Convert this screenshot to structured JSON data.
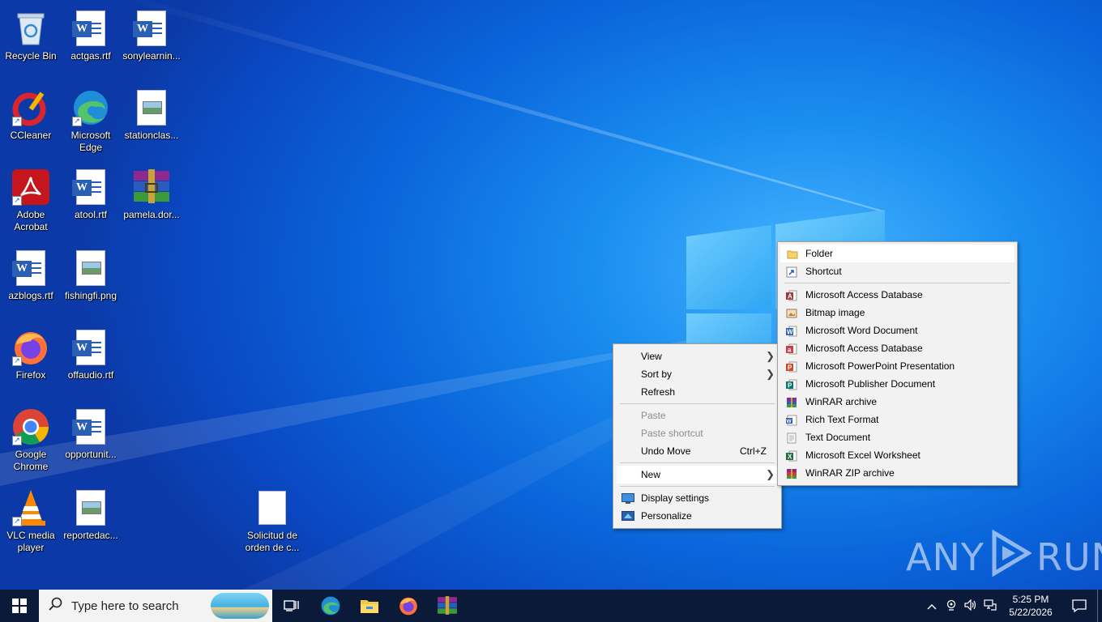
{
  "desktop": {
    "icons": [
      {
        "label": "Recycle Bin"
      },
      {
        "label": "actgas.rtf"
      },
      {
        "label": "sonylearnin..."
      },
      {
        "label": "CCleaner"
      },
      {
        "label": "Microsoft Edge"
      },
      {
        "label": "stationclas..."
      },
      {
        "label": "Adobe Acrobat"
      },
      {
        "label": "atool.rtf"
      },
      {
        "label": "pamela.dor..."
      },
      {
        "label": "azblogs.rtf"
      },
      {
        "label": "fishingfi.png"
      },
      {
        "label": "Firefox"
      },
      {
        "label": "offaudio.rtf"
      },
      {
        "label": "Google Chrome"
      },
      {
        "label": "opportunit..."
      },
      {
        "label": "VLC media player"
      },
      {
        "label": "reportedac..."
      },
      {
        "label": "Solicitud de orden de c..."
      }
    ]
  },
  "context_menu": {
    "items": [
      {
        "label": "View",
        "submenu": true
      },
      {
        "label": "Sort by",
        "submenu": true
      },
      {
        "label": "Refresh"
      },
      {
        "label": "Paste",
        "disabled": true
      },
      {
        "label": "Paste shortcut",
        "disabled": true
      },
      {
        "label": "Undo Move",
        "accelerator": "Ctrl+Z"
      },
      {
        "label": "New",
        "submenu": true,
        "highlighted": true
      },
      {
        "label": "Display settings"
      },
      {
        "label": "Personalize"
      }
    ]
  },
  "new_submenu": {
    "items": [
      {
        "label": "Folder",
        "icon": "folder-icon",
        "highlighted": true
      },
      {
        "label": "Shortcut",
        "icon": "shortcut-icon"
      },
      {
        "label": "Microsoft Access Database",
        "icon": "access-icon"
      },
      {
        "label": "Bitmap image",
        "icon": "bitmap-icon"
      },
      {
        "label": "Microsoft Word Document",
        "icon": "word-icon"
      },
      {
        "label": "Microsoft Access Database",
        "icon": "access-icon"
      },
      {
        "label": "Microsoft PowerPoint Presentation",
        "icon": "powerpoint-icon"
      },
      {
        "label": "Microsoft Publisher Document",
        "icon": "publisher-icon"
      },
      {
        "label": "WinRAR archive",
        "icon": "winrar-icon"
      },
      {
        "label": "Rich Text Format",
        "icon": "rtf-icon"
      },
      {
        "label": "Text Document",
        "icon": "text-icon"
      },
      {
        "label": "Microsoft Excel Worksheet",
        "icon": "excel-icon"
      },
      {
        "label": "WinRAR ZIP archive",
        "icon": "winrar-zip-icon"
      }
    ]
  },
  "taskbar": {
    "search_placeholder": "Type here to search",
    "time": "5:25 PM",
    "date": "5/22/2026"
  },
  "watermark": {
    "left": "ANY",
    "right": "RUN"
  },
  "colors": {
    "taskbar": "#0c1a3a",
    "menu_bg": "#f2f2f2",
    "menu_highlight": "#ffffff",
    "desktop_blue": "#0a66db"
  }
}
